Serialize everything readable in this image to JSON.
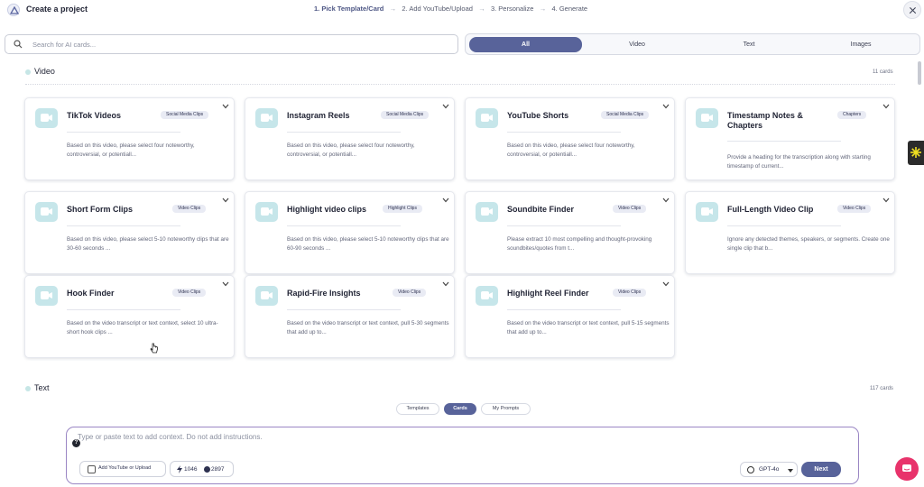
{
  "header": {
    "title": "Create a project",
    "steps": [
      "1. Pick Template/Card",
      "2. Add YouTube/Upload",
      "3. Personalize",
      "4. Generate"
    ],
    "arrow": "→"
  },
  "search": {
    "placeholder": "Search for AI cards..."
  },
  "filters": [
    "All",
    "Video",
    "Text",
    "Images"
  ],
  "video_section": {
    "title": "Video",
    "count": "11 cards",
    "cards": [
      {
        "title": "TikTok Videos",
        "tag": "Social Media Clips",
        "desc": "Based on this video, please select four noteworthy, controversial, or potentiall..."
      },
      {
        "title": "Instagram Reels",
        "tag": "Social Media Clips",
        "desc": "Based on this video, please select four noteworthy, controversial, or potentiall..."
      },
      {
        "title": "YouTube Shorts",
        "tag": "Social Media Clips",
        "desc": "Based on this video, please select four noteworthy, controversial, or potentiall..."
      },
      {
        "title": "Timestamp Notes & Chapters",
        "tag": "Chapters",
        "desc": "Provide a heading for the transcription along with starting timestamp of current..."
      },
      {
        "title": "Short Form Clips",
        "tag": "Video Clips",
        "desc": "Based on this video, please select 5-10 noteworthy clips that are 30-60 seconds ..."
      },
      {
        "title": "Highlight video clips",
        "tag": "Highlight Clips",
        "desc": "Based on this video, please select 5-10 noteworthy clips that are 60-90 seconds ..."
      },
      {
        "title": "Soundbite Finder",
        "tag": "Video Clips",
        "desc": "Please extract 10 most compelling and thought-provoking soundbites/quotes from t..."
      },
      {
        "title": "Full-Length Video Clip",
        "tag": "Video Clips",
        "desc": "Ignore any detected themes, speakers, or segments. Create one single clip that b..."
      },
      {
        "title": "Hook Finder",
        "tag": "Video Clips",
        "desc": "Based on the video transcript or text context, select 10 ultra-short hook clips ..."
      },
      {
        "title": "Rapid-Fire Insights",
        "tag": "Video Clips",
        "desc": "Based on the video transcript or text context, pull 5-30 segments that add up to..."
      },
      {
        "title": "Highlight Reel Finder",
        "tag": "Video Clips",
        "desc": "Based on the video transcript or text context, pull 5-15 segments that add up to..."
      }
    ]
  },
  "text_section": {
    "title": "Text",
    "count": "117 cards"
  },
  "segments": [
    "Templates",
    "Cards",
    "My Prompts"
  ],
  "composer": {
    "placeholder": "Type or paste text to add context. Do not add instructions.",
    "help": "?",
    "add_youtube_label": "Add YouTube or Upload",
    "credits_a": "1046",
    "credits_b": "2897",
    "model": "GPT-4o",
    "next_label": "Next"
  },
  "colors": {
    "accent": "#58639a",
    "thumb": "#c6e6ea",
    "composer_border": "#9a86c4",
    "chat": "#e8336b"
  },
  "icons": [
    "search-icon",
    "close-icon",
    "video-camera-icon",
    "chevron-down-icon",
    "bolt-icon",
    "coin-icon",
    "chat-icon"
  ]
}
